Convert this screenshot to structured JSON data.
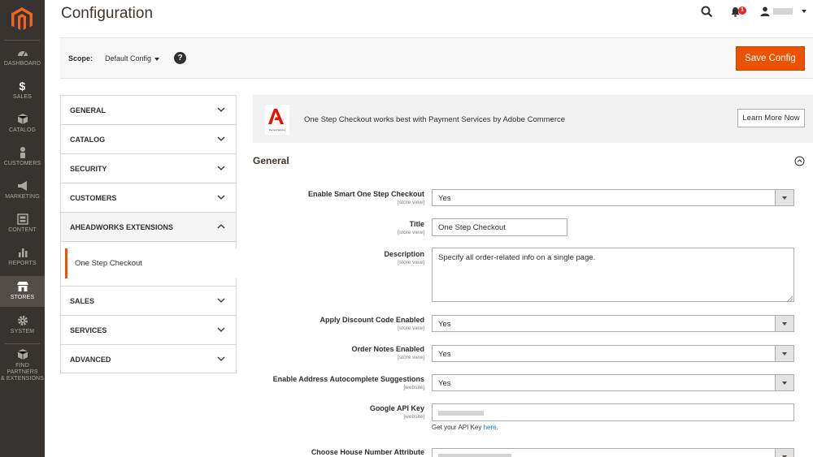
{
  "nav": {
    "items": [
      {
        "label": "DASHBOARD",
        "icon": "dashboard-icon"
      },
      {
        "label": "SALES",
        "icon": "dollar-icon"
      },
      {
        "label": "CATALOG",
        "icon": "cube-icon"
      },
      {
        "label": "CUSTOMERS",
        "icon": "person-icon"
      },
      {
        "label": "MARKETING",
        "icon": "megaphone-icon"
      },
      {
        "label": "CONTENT",
        "icon": "content-icon"
      },
      {
        "label": "REPORTS",
        "icon": "bar-chart-icon"
      },
      {
        "label": "STORES",
        "icon": "store-icon"
      },
      {
        "label": "SYSTEM",
        "icon": "gear-icon"
      },
      {
        "label": "FIND PARTNERS",
        "label2": "& EXTENSIONS",
        "icon": "box-icon"
      }
    ]
  },
  "header": {
    "title": "Configuration",
    "notification_count": "1"
  },
  "actionbar": {
    "scope_label": "Scope:",
    "scope_value": "Default Config",
    "help": "?",
    "save_label": "Save Config"
  },
  "tabs": {
    "general": "GENERAL",
    "catalog": "CATALOG",
    "security": "SECURITY",
    "customers": "CUSTOMERS",
    "aheadworks": "AHEADWORKS EXTENSIONS",
    "one_step_checkout": "One Step Checkout",
    "sales": "SALES",
    "services": "SERVICES",
    "advanced": "ADVANCED"
  },
  "banner": {
    "text": "One Step Checkout works best with Payment Services by Adobe Commerce",
    "button": "Learn More Now",
    "logo_caption": "Payment Services"
  },
  "section": {
    "title": "General"
  },
  "fields": {
    "enable_smart": {
      "label": "Enable Smart One Step Checkout",
      "scope": "[store view]",
      "value": "Yes"
    },
    "title": {
      "label": "Title",
      "scope": "[store view]",
      "value": "One Step Checkout"
    },
    "description": {
      "label": "Description",
      "scope": "[store view]",
      "value": "Specify all order-related info on a single page."
    },
    "discount": {
      "label": "Apply Discount Code Enabled",
      "scope": "[store view]",
      "value": "Yes"
    },
    "order_notes": {
      "label": "Order Notes Enabled",
      "scope": "[store view]",
      "value": "Yes"
    },
    "autocomplete": {
      "label": "Enable Address Autocomplete Suggestions",
      "scope": "[website]",
      "value": "Yes"
    },
    "google_api": {
      "label": "Google API Key",
      "scope": "[website]",
      "note": "Get your API Key",
      "note_link": "here",
      "note_end": "."
    },
    "house_number": {
      "label": "Choose House Number Attribute"
    }
  },
  "colors": {
    "accent": "#eb5202",
    "nav_bg": "#373330",
    "link": "#007bdb"
  }
}
